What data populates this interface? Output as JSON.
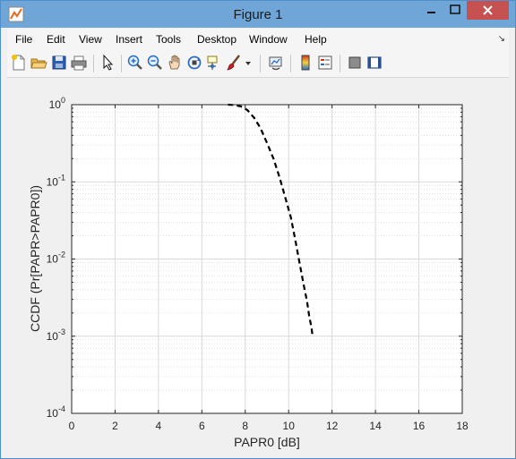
{
  "window": {
    "title": "Figure 1"
  },
  "menu": {
    "items": [
      "File",
      "Edit",
      "View",
      "Insert",
      "Tools",
      "Desktop",
      "Window",
      "Help"
    ]
  },
  "toolbar": {
    "buttons": [
      "new-figure-icon",
      "open-file-icon",
      "save-icon",
      "print-icon",
      "pointer-icon",
      "zoom-in-icon",
      "zoom-out-icon",
      "pan-icon",
      "rotate-3d-icon",
      "data-cursor-icon",
      "brush-icon",
      "dropdown-arrow-icon",
      "link-plot-icon",
      "colorbar-icon",
      "legend-icon",
      "hide-plot-tools-icon",
      "show-plot-tools-icon"
    ]
  },
  "chart_data": {
    "type": "line",
    "title": "",
    "xlabel": "PAPR0 [dB]",
    "ylabel": "CCDF (Pr[PAPR>PAPR0])",
    "xlim": [
      0,
      18
    ],
    "ylim": [
      0.0001,
      1
    ],
    "yscale": "log",
    "grid": true,
    "x_ticks": [
      "0",
      "2",
      "4",
      "6",
      "8",
      "10",
      "12",
      "14",
      "16",
      "18"
    ],
    "y_ticks": [
      {
        "base": "10",
        "exp": "-4"
      },
      {
        "base": "10",
        "exp": "-3"
      },
      {
        "base": "10",
        "exp": "-2"
      },
      {
        "base": "10",
        "exp": "-1"
      },
      {
        "base": "10",
        "exp": "0"
      }
    ],
    "series": [
      {
        "style": "dashed",
        "color": "#000000",
        "x": [
          7.2,
          7.5,
          7.8,
          8.1,
          8.4,
          8.7,
          9.0,
          9.3,
          9.6,
          9.9,
          10.1,
          10.3,
          10.5,
          10.7,
          10.85,
          10.95,
          11.05,
          11.1
        ],
        "y": [
          1.0,
          0.99,
          0.95,
          0.85,
          0.68,
          0.5,
          0.32,
          0.2,
          0.11,
          0.055,
          0.035,
          0.018,
          0.009,
          0.0045,
          0.0028,
          0.0018,
          0.0013,
          0.001
        ]
      }
    ]
  },
  "colors": {
    "titlebar": "#6fa5d7",
    "close_button": "#c75050",
    "axes_background": "#ffffff",
    "grid": "#d9d9d9"
  }
}
